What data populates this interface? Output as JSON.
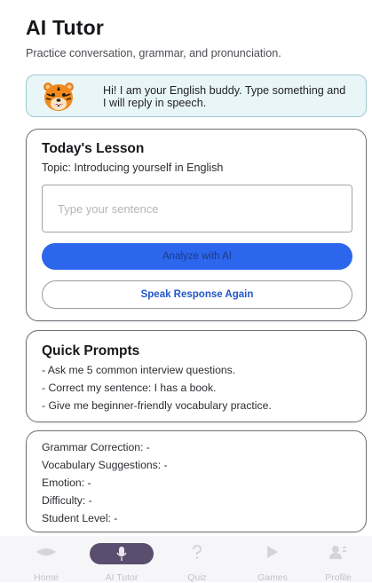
{
  "header": {
    "title": "AI Tutor",
    "subtitle": "Practice conversation, grammar, and pronunciation."
  },
  "greeting": {
    "avatar_icon": "tiger-face-icon",
    "message": "Hi! I am your English buddy. Type something and I will reply in speech."
  },
  "lesson": {
    "heading": "Today's Lesson",
    "topic": "Topic: Introducing yourself in English",
    "input": {
      "placeholder": "Type your sentence",
      "value": ""
    },
    "analyze_label": "Analyze with AI",
    "speak_label": "Speak Response Again"
  },
  "quick_prompts": {
    "heading": "Quick Prompts",
    "items": [
      "- Ask me 5 common interview questions.",
      "- Correct my sentence: I has a book.",
      "- Give me beginner-friendly vocabulary practice."
    ]
  },
  "analysis": {
    "rows": [
      "Grammar Correction: -",
      "Vocabulary Suggestions: -",
      "Emotion: -",
      "Difficulty: -",
      "Student Level: -"
    ]
  },
  "nav": {
    "items": [
      {
        "label": "Home",
        "icon": "home-icon",
        "active": false
      },
      {
        "label": "AI Tutor",
        "icon": "microphone-icon",
        "active": true
      },
      {
        "label": "Quiz",
        "icon": "question-mark-icon",
        "active": false
      },
      {
        "label": "Games",
        "icon": "play-icon",
        "active": false
      },
      {
        "label": "Profile",
        "icon": "profile-icon",
        "active": false
      }
    ]
  },
  "colors": {
    "accent": "#2c66ec",
    "bubble_bg": "#e9f6f8",
    "nav_active_pill": "#5a4e6e"
  }
}
